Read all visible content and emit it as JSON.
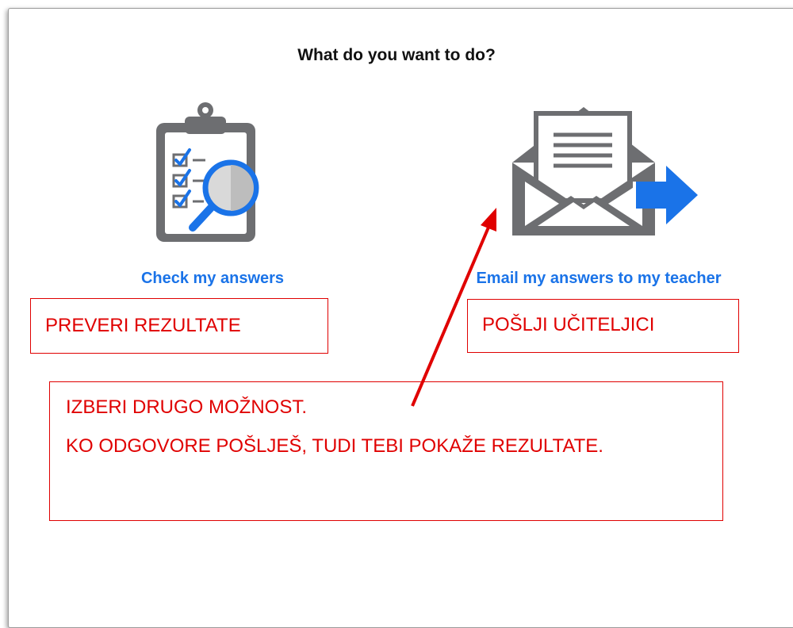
{
  "dialog": {
    "title": "What do you want to do?"
  },
  "options": {
    "check": {
      "label": "Check my answers",
      "icon": "clipboard-magnifier-icon"
    },
    "email": {
      "label": "Email my answers to my teacher",
      "icon": "envelope-arrow-icon"
    }
  },
  "annotations": {
    "preveri": "PREVERI REZULTATE",
    "poslji": "POŠLJI UČITELJICI",
    "izberi_line1": "IZBERI DRUGO MOŽNOST.",
    "izberi_line2": "KO ODGOVORE POŠLJEŠ, TUDI TEBI POKAŽE REZULTATE."
  },
  "colors": {
    "link_blue": "#1a73e8",
    "annotation_red": "#e00000",
    "icon_gray": "#6d6e71",
    "icon_blue": "#1a73e8"
  }
}
